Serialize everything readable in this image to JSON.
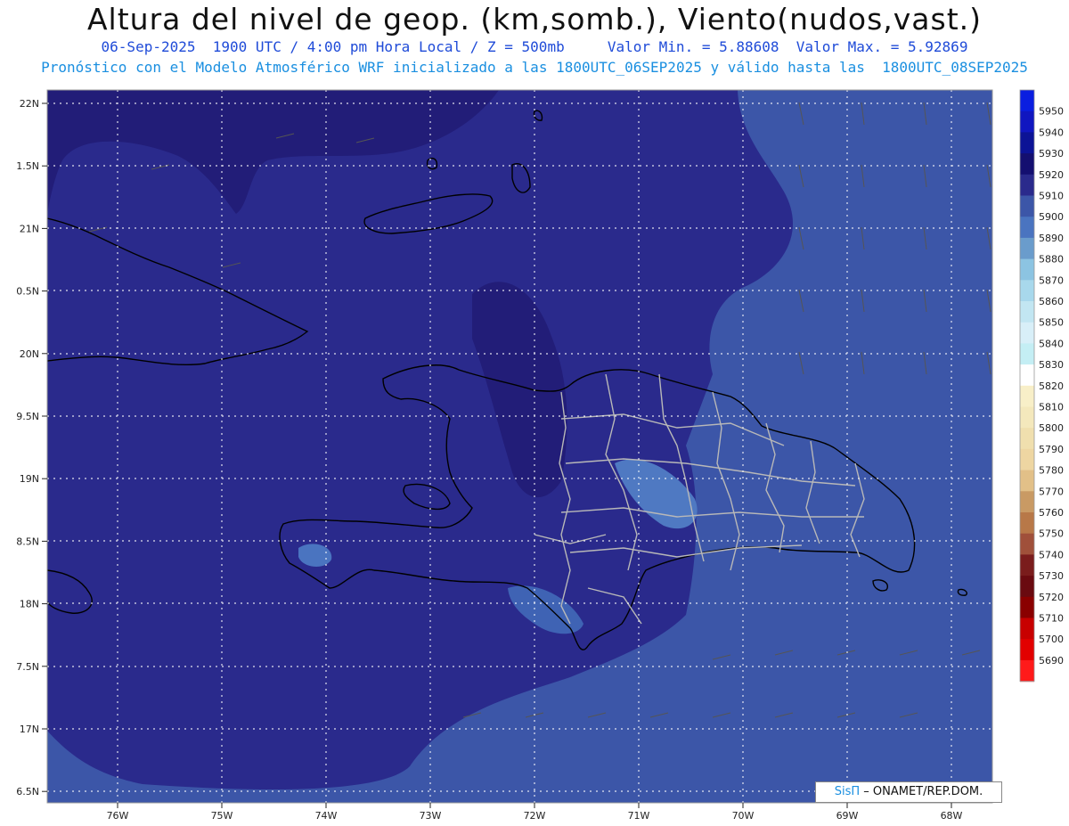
{
  "title": "Altura del nivel de geop. (km,somb.), Viento(nudos,vast.)",
  "subtitle_line1": "06-Sep-2025  1900 UTC / 4:00 pm Hora Local / Z = 500mb     Valor Min. = 5.88608  Valor Max. = 5.92869",
  "subtitle_line2": "Pronóstico con el Modelo Atmosférico WRF inicializado a las 1800UTC_06SEP2025 y válido hasta las  1800UTC_08SEP2025",
  "lat_labels": [
    "22N",
    "1.5N",
    "21N",
    "0.5N",
    "20N",
    "9.5N",
    "19N",
    "8.5N",
    "18N",
    "7.5N",
    "17N",
    "6.5N"
  ],
  "lon_labels": [
    "76W",
    "75W",
    "74W",
    "73W",
    "72W",
    "71W",
    "70W",
    "69W",
    "68W"
  ],
  "colorbar": [
    {
      "label": "5950",
      "color": "#0a1ee0"
    },
    {
      "label": "5940",
      "color": "#1016c0"
    },
    {
      "label": "5930",
      "color": "#0c1396"
    },
    {
      "label": "5920",
      "color": "#140f70"
    },
    {
      "label": "5910",
      "color": "#2a2a8c"
    },
    {
      "label": "5900",
      "color": "#3c56a8"
    },
    {
      "label": "5890",
      "color": "#4a74c0"
    },
    {
      "label": "5880",
      "color": "#6a9ccc"
    },
    {
      "label": "5870",
      "color": "#8cc4e2"
    },
    {
      "label": "5860",
      "color": "#a8d8ec"
    },
    {
      "label": "5850",
      "color": "#c2e6f2"
    },
    {
      "label": "5840",
      "color": "#d8eff8"
    },
    {
      "label": "5830",
      "color": "#c4eef4"
    },
    {
      "label": "5820",
      "color": "#ffffff"
    },
    {
      "label": "5810",
      "color": "#f8efc8"
    },
    {
      "label": "5800",
      "color": "#f4e8bc"
    },
    {
      "label": "5790",
      "color": "#f0dfae"
    },
    {
      "label": "5780",
      "color": "#eed6a2"
    },
    {
      "label": "5770",
      "color": "#e2c088"
    },
    {
      "label": "5760",
      "color": "#c99a64"
    },
    {
      "label": "5750",
      "color": "#b87848"
    },
    {
      "label": "5740",
      "color": "#a0503a"
    },
    {
      "label": "5730",
      "color": "#7a1c1c"
    },
    {
      "label": "5720",
      "color": "#6a0a10"
    },
    {
      "label": "5710",
      "color": "#8a0000"
    },
    {
      "label": "5700",
      "color": "#c80000"
    },
    {
      "label": "5690",
      "color": "#e20000"
    },
    {
      "label": "",
      "color": "#ff1a1a"
    }
  ],
  "credit": {
    "brand": "SisΠ",
    "text": " – ONAMET/REP.DOM."
  }
}
